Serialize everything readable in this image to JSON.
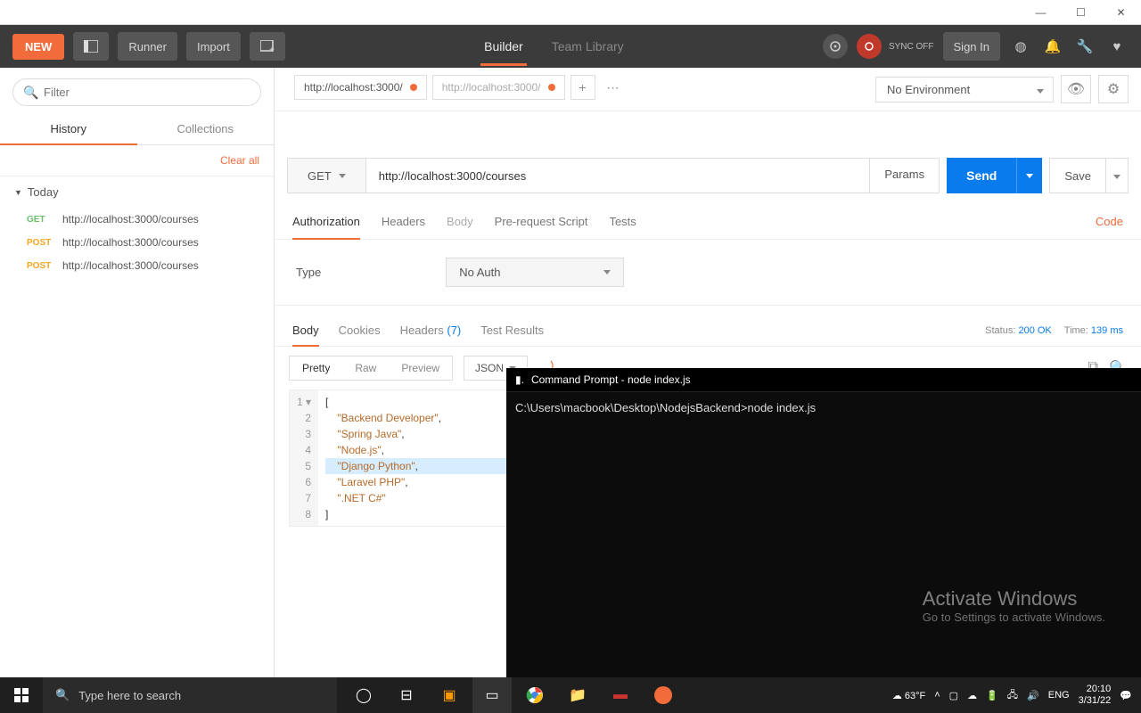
{
  "window": {
    "title": ""
  },
  "toolbar": {
    "new": "NEW",
    "runner": "Runner",
    "import": "Import",
    "builder": "Builder",
    "team_library": "Team Library",
    "sync_off": "SYNC OFF",
    "sign_in": "Sign In"
  },
  "sidebar": {
    "filter_placeholder": "Filter",
    "tab_history": "History",
    "tab_collections": "Collections",
    "clear_all": "Clear all",
    "group_today": "Today",
    "items": [
      {
        "method": "GET",
        "url": "http://localhost:3000/courses"
      },
      {
        "method": "POST",
        "url": "http://localhost:3000/courses"
      },
      {
        "method": "POST",
        "url": "http://localhost:3000/courses"
      }
    ]
  },
  "env": {
    "no_env": "No Environment"
  },
  "tabs": {
    "t1": "http://localhost:3000/",
    "t2": "http://localhost:3000/"
  },
  "request": {
    "method": "GET",
    "url": "http://localhost:3000/courses",
    "params": "Params",
    "send": "Send",
    "save": "Save"
  },
  "subtabs": {
    "authorization": "Authorization",
    "headers": "Headers",
    "body": "Body",
    "prerequest": "Pre-request Script",
    "tests": "Tests",
    "code": "Code"
  },
  "auth": {
    "type_label": "Type",
    "no_auth": "No Auth"
  },
  "resp": {
    "body": "Body",
    "cookies": "Cookies",
    "headers": "Headers",
    "hdr_count": "(7)",
    "test_results": "Test Results",
    "status_lbl": "Status:",
    "status_val": "200 OK",
    "time_lbl": "Time:",
    "time_val": "139 ms"
  },
  "body_tools": {
    "pretty": "Pretty",
    "raw": "Raw",
    "preview": "Preview",
    "json": "JSON"
  },
  "code": {
    "l1": "[",
    "l2": "\"Backend Developer\"",
    "l3": "\"Spring Java\"",
    "l4": "\"Node.js\"",
    "l5": "\"Django Python\"",
    "l6": "\"Laravel PHP\"",
    "l7": "\".NET C#\"",
    "l8": "]",
    "n1": "1",
    "n2": "2",
    "n3": "3",
    "n4": "4",
    "n5": "5",
    "n6": "6",
    "n7": "7",
    "n8": "8"
  },
  "terminal": {
    "title": "Command Prompt - node  index.js",
    "line1": "C:\\Users\\macbook\\Desktop\\NodejsBackend>node index.js"
  },
  "watermark": {
    "t1": "Activate Windows",
    "t2": "Go to Settings to activate Windows."
  },
  "taskbar": {
    "search": "Type here to search",
    "weather": "63°F",
    "lang": "ENG",
    "time": "20:10",
    "date": "3/31/22"
  }
}
